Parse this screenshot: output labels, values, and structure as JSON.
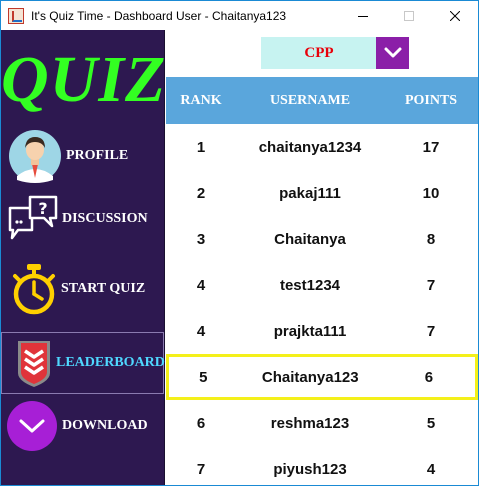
{
  "window": {
    "title": "It's Quiz Time - Dashboard User - Chaitanya123",
    "controls": [
      "minimize",
      "maximize",
      "close"
    ]
  },
  "sidebar": {
    "logo": "QUIZ",
    "items": [
      {
        "label": "PROFILE",
        "icon": "user-avatar-icon"
      },
      {
        "label": "DISCUSSION",
        "icon": "chat-bubbles-icon"
      },
      {
        "label": "START QUIZ",
        "icon": "stopwatch-icon"
      },
      {
        "label": "LEADERBOARD",
        "icon": "rank-badge-icon",
        "active": true
      },
      {
        "label": "DOWNLOAD",
        "icon": "chevron-down-icon"
      }
    ]
  },
  "filter": {
    "selected": "CPP"
  },
  "leaderboard": {
    "columns": {
      "rank": "RANK",
      "username": "USERNAME",
      "points": "POINTS"
    },
    "rows": [
      {
        "rank": "1",
        "username": "chaitanya1234",
        "points": "17"
      },
      {
        "rank": "2",
        "username": "pakaj111",
        "points": "10"
      },
      {
        "rank": "3",
        "username": "Chaitanya",
        "points": "8"
      },
      {
        "rank": "4",
        "username": "test1234",
        "points": "7"
      },
      {
        "rank": "4",
        "username": "prajkta111",
        "points": "7"
      },
      {
        "rank": "5",
        "username": "Chaitanya123",
        "points": "6",
        "current_user": true
      },
      {
        "rank": "6",
        "username": "reshma123",
        "points": "5"
      },
      {
        "rank": "7",
        "username": "piyush123",
        "points": "4"
      }
    ]
  },
  "colors": {
    "sidebar_bg": "#2d1850",
    "logo": "#33ff22",
    "active_label": "#4fd8ff",
    "table_header": "#5aa6dc",
    "select_bg": "#c7f3f1",
    "select_text": "#e8000a",
    "select_arrow_bg": "#8b1fa8",
    "highlight_border": "#f4f01a"
  }
}
